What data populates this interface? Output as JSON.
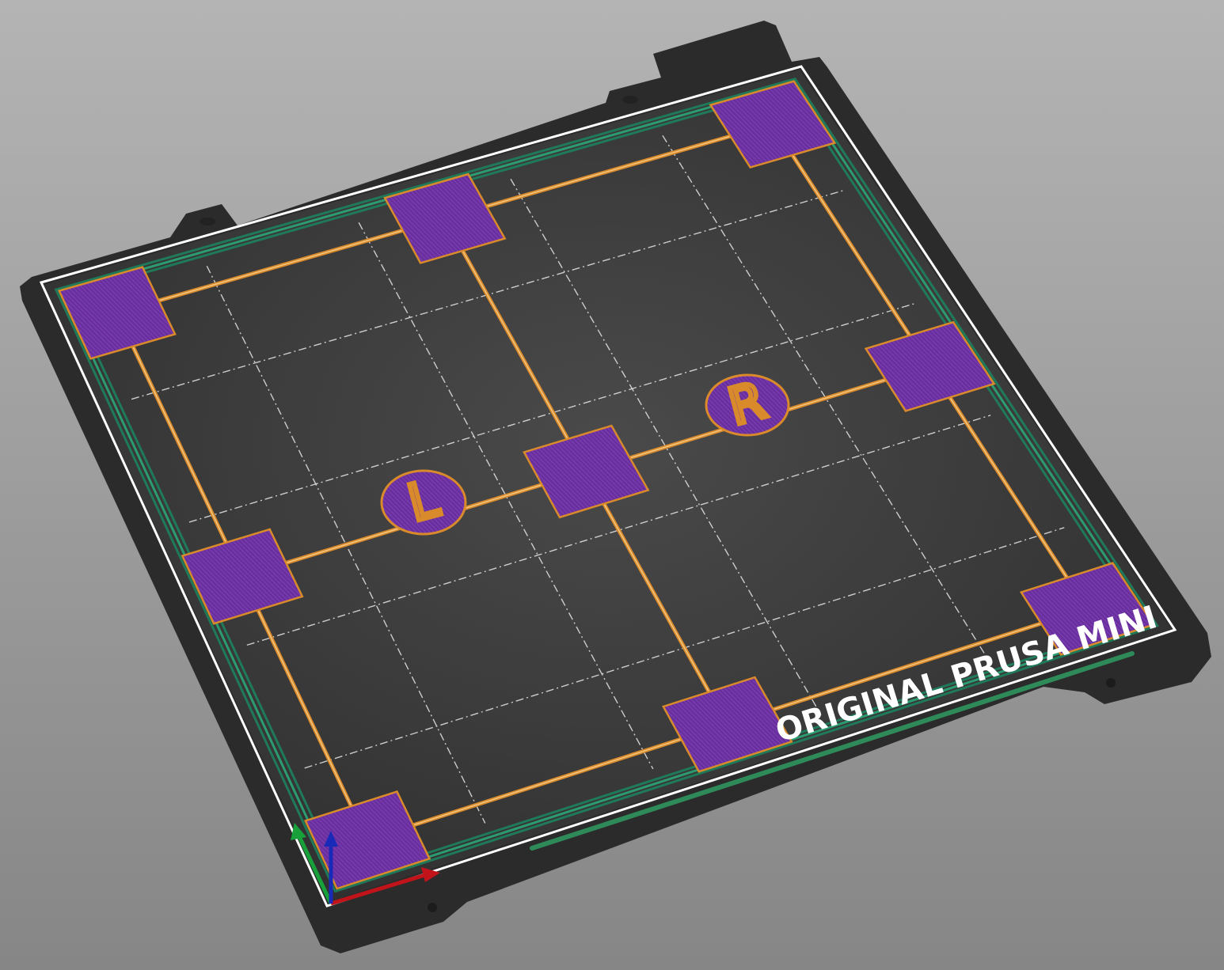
{
  "viewport": {
    "background_top": "#b4b4b4",
    "background_bottom": "#868686"
  },
  "bed": {
    "label": "ORIGINAL PRUSA MINI",
    "sheet_color": "#2b2b2b",
    "bed_surface_color": "#3a3a3a",
    "grid_line_color": "#e6e6e6",
    "print_area_border_color": "#ffffff",
    "skirt_color": "#1f7a5a"
  },
  "print": {
    "pad_fill_color": "#6a2f9e",
    "pad_outline_color": "#d98a2b",
    "connector_color": "#d98a2b",
    "markers": [
      {
        "letter": "L"
      },
      {
        "letter": "R"
      }
    ]
  },
  "axes": {
    "x_color": "#c0141a",
    "y_color": "#18a03a",
    "z_color": "#1a2ab8"
  }
}
